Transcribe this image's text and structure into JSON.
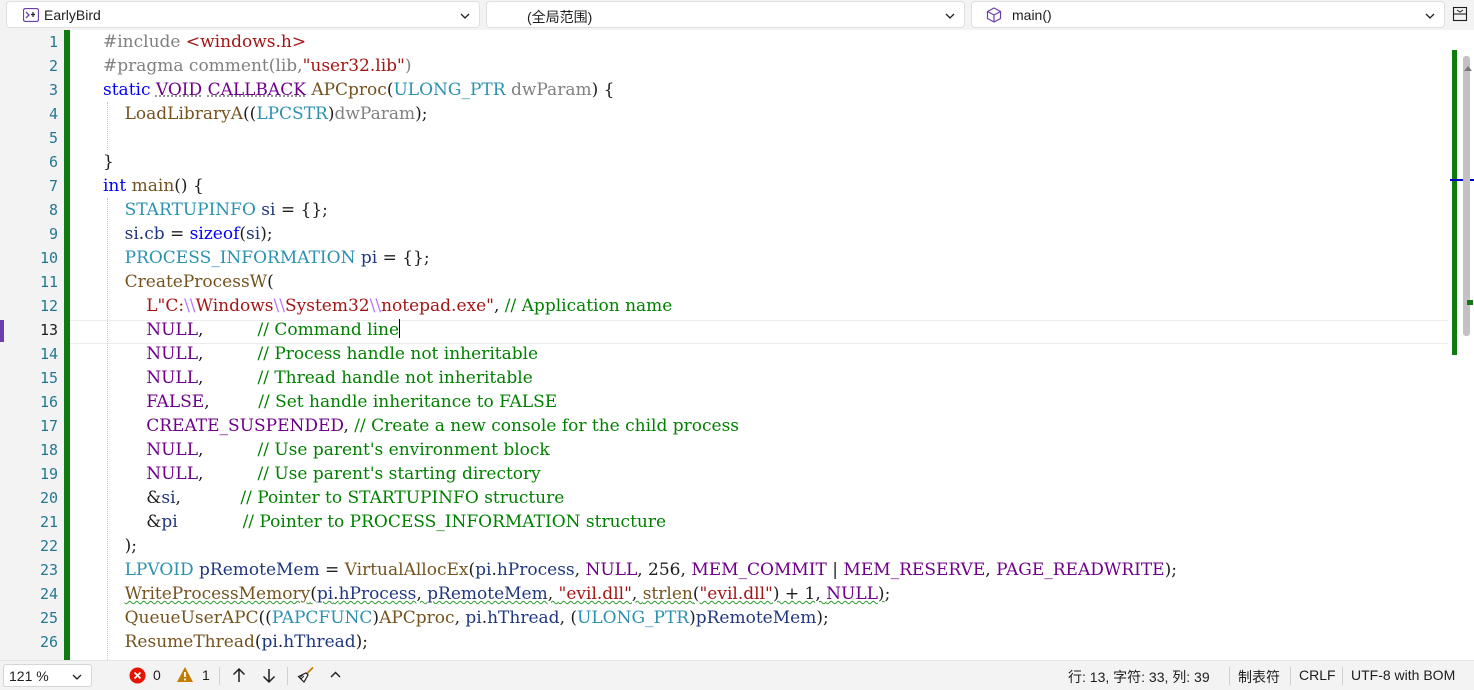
{
  "navbar": {
    "project": "EarlyBird",
    "scope": "(全局范围)",
    "member": "main()"
  },
  "editor": {
    "line_numbers": [
      "1",
      "2",
      "3",
      "4",
      "5",
      "6",
      "7",
      "8",
      "9",
      "10",
      "11",
      "12",
      "13",
      "14",
      "15",
      "16",
      "17",
      "18",
      "19",
      "20",
      "21",
      "22",
      "23",
      "24",
      "25",
      "26"
    ],
    "current_line": "13"
  },
  "statusbar": {
    "zoom": "121 %",
    "errors": "0",
    "warnings": "1",
    "position": "行: 13, 字符: 33, 列: 39",
    "indent": "制表符",
    "line_ending": "CRLF",
    "encoding": "UTF-8 with BOM"
  },
  "colors": {
    "change_bar": "#107c10",
    "keyword": "#0000ff",
    "macro": "#6f008a",
    "comment": "#008000",
    "string": "#a31515",
    "type": "#2b91af"
  }
}
